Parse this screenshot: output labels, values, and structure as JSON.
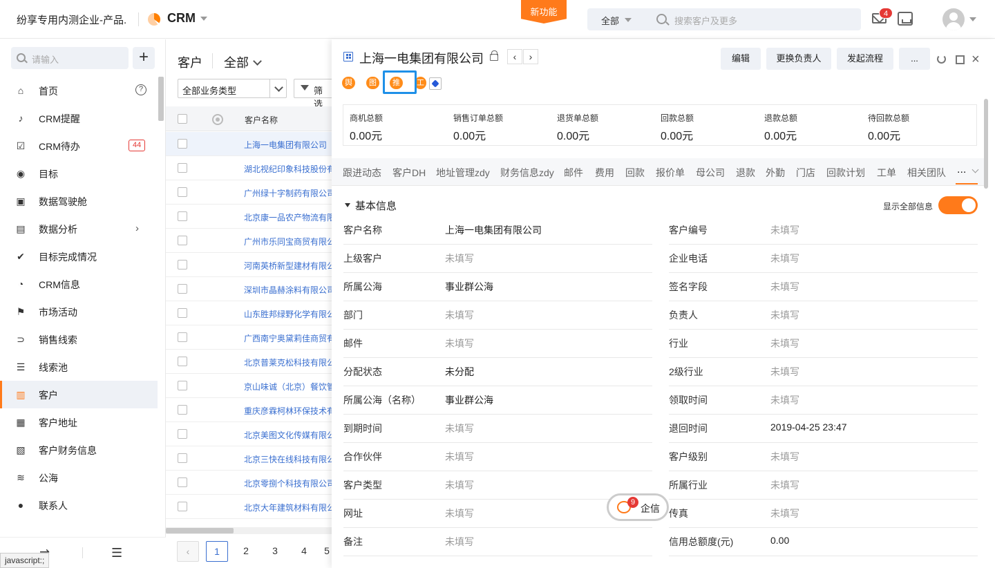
{
  "header": {
    "company": "纷享专用内测企业-产品...",
    "app_name": "CRM",
    "new_feature": "新功能",
    "search_scope": "全部",
    "search_placeholder": "搜索客户及更多",
    "mail_badge": "4"
  },
  "sidebar": {
    "search_placeholder": "请输入",
    "items": [
      {
        "label": "首页",
        "icon": "home-icon"
      },
      {
        "label": "CRM提醒",
        "icon": "bell-icon"
      },
      {
        "label": "CRM待办",
        "icon": "todo-icon",
        "badge": "44"
      },
      {
        "label": "目标",
        "icon": "target-icon"
      },
      {
        "label": "数据驾驶舱",
        "icon": "dashboard-icon"
      },
      {
        "label": "数据分析",
        "icon": "folder-icon"
      },
      {
        "label": "目标完成情况",
        "icon": "shield-check-icon"
      },
      {
        "label": "CRM信息",
        "icon": "pie-icon"
      },
      {
        "label": "市场活动",
        "icon": "flag-icon"
      },
      {
        "label": "销售线索",
        "icon": "lead-icon"
      },
      {
        "label": "线索池",
        "icon": "pool-icon"
      },
      {
        "label": "客户",
        "icon": "building-icon",
        "active": true
      },
      {
        "label": "客户地址",
        "icon": "address-icon"
      },
      {
        "label": "客户财务信息",
        "icon": "finance-icon"
      },
      {
        "label": "公海",
        "icon": "waves-icon"
      },
      {
        "label": "联系人",
        "icon": "person-icon"
      }
    ],
    "status_text": "javascript:;"
  },
  "list": {
    "title": "客户",
    "scope": "全部",
    "biz_type": "全部业务类型",
    "filter": "筛选",
    "col_name": "客户名称",
    "rows": [
      "上海一电集团有限公司",
      "湖北视纪印象科技股份有",
      "广州绿十字制药有限公司",
      "北京康一品农产物流有限",
      "广州市乐同宝商贸有限公",
      "河南英桥新型建材有限公",
      "深圳市晶赫涂料有限公司",
      "山东胜邦绿野化学有限公",
      "广西南宁奥黛莉佳商贸有",
      "北京普莱克松科技有限公",
      "京山味诚（北京）餐饮管",
      "重庆彦霖柯林环保技术有",
      "北京美图文化传媒有限公",
      "北京三快在线科技有限公",
      "北京零捌个科技有限公司",
      "北京大年建筑材料有限公"
    ],
    "pages": [
      "1",
      "2",
      "3",
      "4",
      "5"
    ]
  },
  "detail": {
    "title": "上海一电集团有限公司",
    "buttons": {
      "edit": "编辑",
      "change_owner": "更换负责人",
      "start_flow": "发起流程",
      "more": "..."
    },
    "tags": [
      "舆情",
      "图谱",
      "推荐",
      "工"
    ],
    "stats": [
      {
        "label": "商机总额",
        "value": "0.00元"
      },
      {
        "label": "销售订单总额",
        "value": "0.00元"
      },
      {
        "label": "退货单总额",
        "value": "0.00元"
      },
      {
        "label": "回款总额",
        "value": "0.00元"
      },
      {
        "label": "退款总额",
        "value": "0.00元"
      },
      {
        "label": "待回款总额",
        "value": "0.00元"
      }
    ],
    "tabs": [
      "跟进动态",
      "客户DH",
      "地址管理zdy",
      "财务信息zdy",
      "邮件",
      "费用",
      "回款",
      "报价单",
      "母公司",
      "退款",
      "外勤",
      "门店",
      "回款计划",
      "工单",
      "相关团队"
    ],
    "tab_more": "...",
    "section_title": "基本信息",
    "show_all": "显示全部信息",
    "fields_left": [
      {
        "label": "客户名称",
        "value": "上海一电集团有限公司"
      },
      {
        "label": "上级客户",
        "value": "未填写",
        "empty": true
      },
      {
        "label": "所属公海",
        "value": "事业群公海"
      },
      {
        "label": "部门",
        "value": "未填写",
        "empty": true
      },
      {
        "label": "邮件",
        "value": "未填写",
        "empty": true
      },
      {
        "label": "分配状态",
        "value": "未分配"
      },
      {
        "label": "所属公海（名称）",
        "value": "事业群公海"
      },
      {
        "label": "到期时间",
        "value": "未填写",
        "empty": true
      },
      {
        "label": "合作伙伴",
        "value": "未填写",
        "empty": true
      },
      {
        "label": "客户类型",
        "value": "未填写",
        "empty": true
      },
      {
        "label": "网址",
        "value": "未填写",
        "empty": true
      },
      {
        "label": "备注",
        "value": "未填写",
        "empty": true
      }
    ],
    "fields_right": [
      {
        "label": "客户编号",
        "value": "未填写",
        "empty": true
      },
      {
        "label": "企业电话",
        "value": "未填写",
        "empty": true
      },
      {
        "label": "签名字段",
        "value": "未填写",
        "empty": true
      },
      {
        "label": "负责人",
        "value": "未填写",
        "empty": true
      },
      {
        "label": "行业",
        "value": "未填写",
        "empty": true
      },
      {
        "label": "2级行业",
        "value": "未填写",
        "empty": true
      },
      {
        "label": "领取时间",
        "value": "未填写",
        "empty": true
      },
      {
        "label": "退回时间",
        "value": "2019-04-25 23:47"
      },
      {
        "label": "客户级别",
        "value": "未填写",
        "empty": true
      },
      {
        "label": "所属行业",
        "value": "未填写",
        "empty": true
      },
      {
        "label": "传真",
        "value": "未填写",
        "empty": true
      },
      {
        "label": "信用总额度(元)",
        "value": "0.00"
      }
    ]
  },
  "qixin": {
    "label": "企信",
    "badge": "9"
  },
  "colors": {
    "accent": "#ff7a1a",
    "link": "#3a6fd0",
    "highlight": "#1e90e8"
  }
}
